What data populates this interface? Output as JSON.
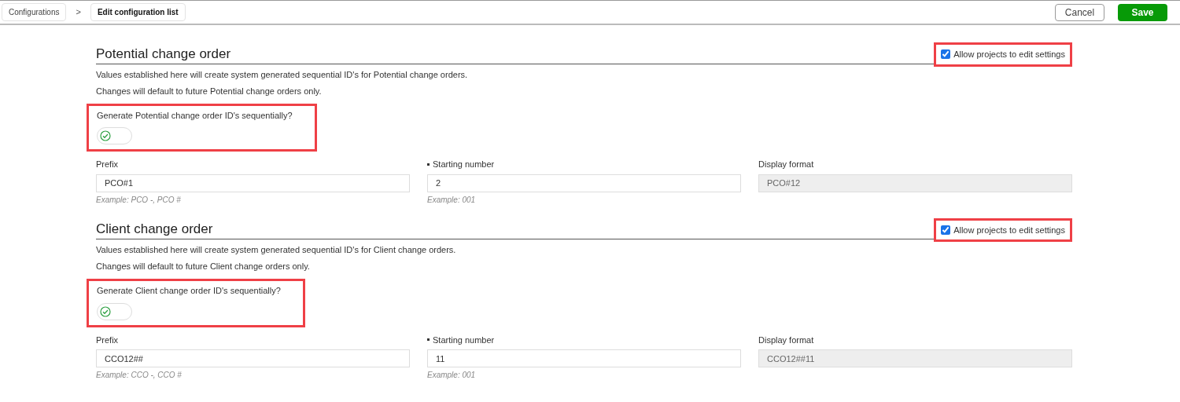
{
  "breadcrumb": [
    {
      "label": "Configurations",
      "selected": false
    },
    {
      "label": "Edit configuration list",
      "selected": true
    }
  ],
  "breadcrumb_separator": ">",
  "actions": {
    "cancel": "Cancel",
    "save": "Save"
  },
  "sections": [
    {
      "title": "Potential change order",
      "allow": {
        "label": "Allow projects to edit settings",
        "checked": true,
        "highlighted": true
      },
      "lines": [
        "Values established here will create system generated sequential ID's for Potential change orders.",
        "Changes will default to future Potential change orders only."
      ],
      "toggle": {
        "label": "Generate Potential change order ID's sequentially?",
        "on": true,
        "highlighted": true
      },
      "fields": [
        {
          "label": "Prefix",
          "required": false,
          "value": "PCO#1",
          "hint": "Example: PCO -, PCO #",
          "disabled": false
        },
        {
          "label": "Starting number",
          "required": true,
          "value": "2",
          "hint": "Example: 001",
          "disabled": false
        },
        {
          "label": "Display format",
          "required": false,
          "value": "PCO#12",
          "disabled": true
        }
      ]
    },
    {
      "title": "Client change order",
      "allow": {
        "label": "Allow projects to edit settings",
        "checked": true,
        "highlighted": true
      },
      "lines": [
        "Values established here will create system generated sequential ID's for Client change orders.",
        "Changes will default to future Client change orders only."
      ],
      "toggle": {
        "label": "Generate Client change order ID's sequentially?",
        "on": true,
        "highlighted": true
      },
      "fields": [
        {
          "label": "Prefix",
          "required": false,
          "value": "CCO12##",
          "hint": "Example: CCO -, CCO #",
          "disabled": false
        },
        {
          "label": "Starting number",
          "required": true,
          "value": "11",
          "hint": "Example: 001",
          "disabled": false
        },
        {
          "label": "Display format",
          "required": false,
          "value": "CCO12##11",
          "disabled": true
        }
      ]
    }
  ]
}
